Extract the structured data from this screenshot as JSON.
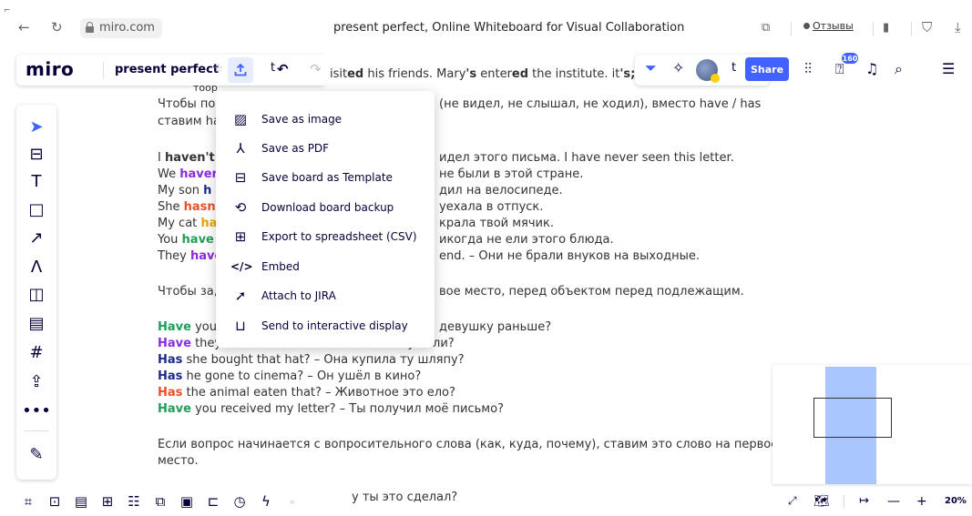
{
  "browser": {
    "url": "miro.com",
    "title": "present perfect, Online Whiteboard for Visual Collaboration",
    "reviews_label": "Отзывы"
  },
  "toolbar": {
    "logo": "miro",
    "board_name": "present perfect",
    "share_label": "Share",
    "notifications_count": "160"
  },
  "export_menu": {
    "items": [
      {
        "label": "Save as image",
        "icon": "image-icon"
      },
      {
        "label": "Save as PDF",
        "icon": "pdf-icon"
      },
      {
        "label": "Save board as Template",
        "icon": "template-icon"
      },
      {
        "label": "Download board backup",
        "icon": "backup-icon"
      },
      {
        "label": "Export to spreadsheet (CSV)",
        "icon": "table-icon"
      },
      {
        "label": "Embed",
        "icon": "code-icon"
      },
      {
        "label": "Attach to JIRA",
        "icon": "jira-icon"
      },
      {
        "label": "Send to interactive display",
        "icon": "display-icon"
      }
    ]
  },
  "board_text": {
    "l0a": "t",
    "l0b": "isit",
    "l0c": "ed",
    "l0d": " his friends. Mary",
    "l0e": "'s",
    "l0f": " enter",
    "l0g": "ed",
    "l0h": " the institute. it",
    "l0i": "'s;",
    "l0j": " t",
    "l1": "тоор",
    "l2a": "Чтобы по",
    "l2b": "(не видел, не слышал, не ходил), вместо have / has",
    "l3": "ставим ha",
    "l4a": "I ",
    "l4b": "haven't",
    "l4c": "идел этого письма. I have never seen this letter.",
    "l5a": "We ",
    "l5b": "haver",
    "l5c": "не были в этой стране.",
    "l6a": "My son ",
    "l6b": "h",
    "l6c": "дил на велосипеде.",
    "l7a": "She ",
    "l7b": "hasn'",
    "l7c": "уехала в отпуск.",
    "l8a": "My cat ",
    "l8b": "ha",
    "l8c": "крала твой мячик.",
    "l9a": "You ",
    "l9b": "have",
    "l9c": "икогда не ели этого блюда.",
    "l10a": "They ",
    "l10b": "have",
    "l10c": "end. – Они не брали внуков на выходные.",
    "l11a": "Чтобы за,",
    "l11b": "вое место, перед объектом перед подлежащим.",
    "l12a": "Have",
    "l12b": " you",
    "l12c": "девушку раньше?",
    "l13a": "Have",
    "l13b": " they listened to me? – Они меня слушали?",
    "l14a": "Has",
    "l14b": " she bought that hat? – Она купила ту шляпу?",
    "l15a": "Has",
    "l15b": " he gone to cinema? – Он ушёл в кино?",
    "l16a": "Has",
    "l16b": " the animal eaten that? – Животное это ело?",
    "l17a": "Have",
    "l17b": " you received my letter? – Ты получил моё письмо?",
    "l18": "Если вопрос начинается с вопросительного слова (как, куда, почему), ставим это слово на первое",
    "l19": "место.",
    "l20": "у ты это сделал?"
  },
  "zoom": {
    "level": "20%"
  },
  "colors": {
    "accent": "#4262ff",
    "have_green": "#1f9e5a",
    "have_purple": "#8a2be2",
    "has_navy": "#1c2b8a",
    "has_orange": "#e8522a",
    "minimap_fill": "#a9c6ff"
  }
}
